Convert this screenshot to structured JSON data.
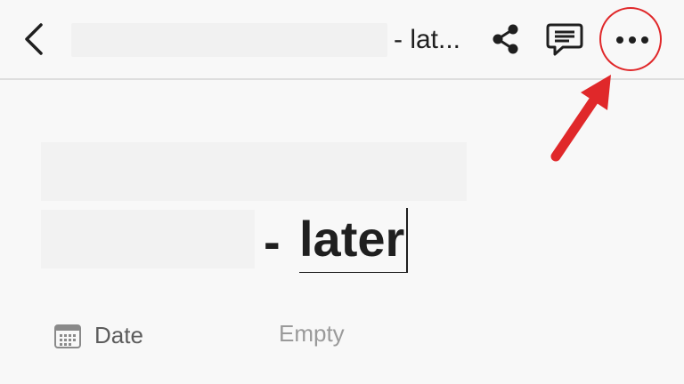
{
  "header": {
    "title_suffix": "- lat...",
    "back_icon": "chevron-left-icon",
    "share_icon": "share-icon",
    "comment_icon": "comment-icon",
    "more_icon": "more-horizontal-icon"
  },
  "page": {
    "title_dash": "-",
    "title_word": "later"
  },
  "properties": [
    {
      "icon": "calendar-icon",
      "label": "Date",
      "value": "Empty"
    }
  ],
  "colors": {
    "annotation_red": "#e0282a",
    "text_primary": "#1f1f1f",
    "text_secondary": "#5c5c5c",
    "text_placeholder": "#9a9a9a"
  }
}
